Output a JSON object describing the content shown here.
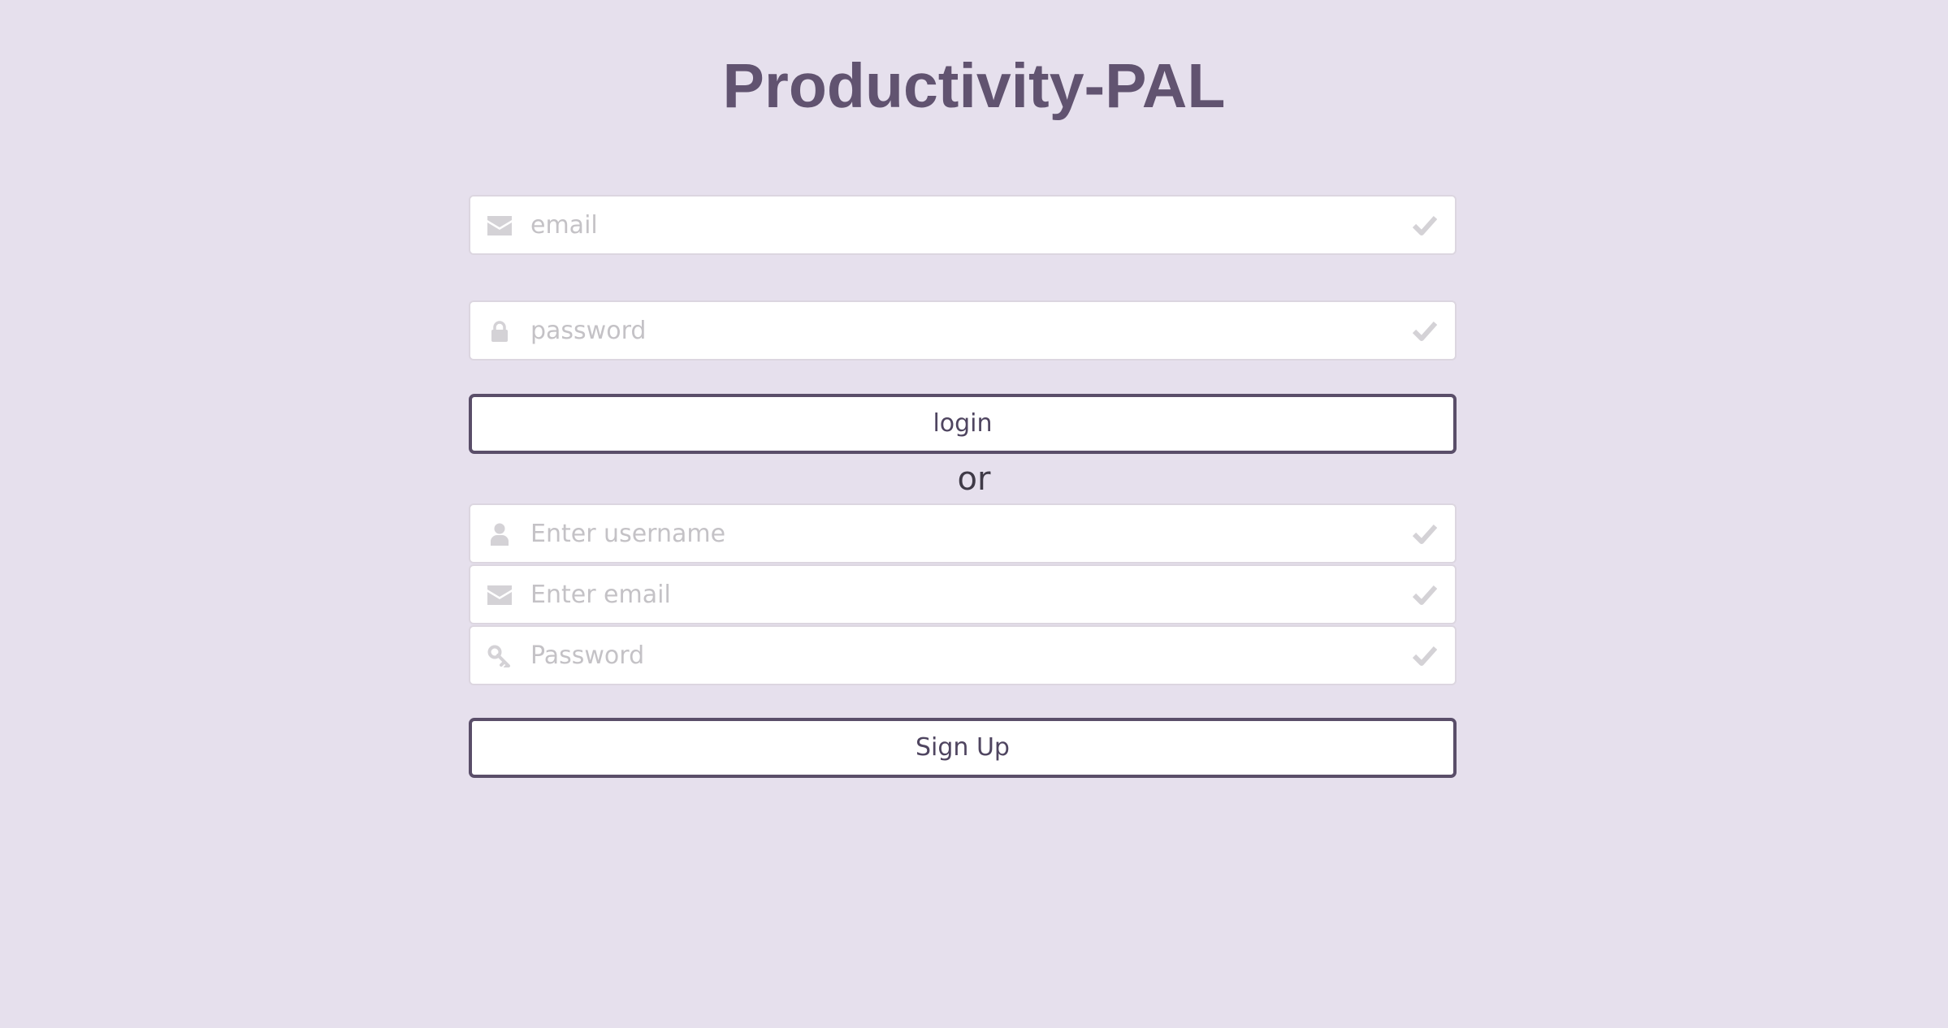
{
  "app": {
    "title": "Productivity-PAL"
  },
  "login": {
    "email_placeholder": "email",
    "password_placeholder": "password",
    "button_label": "login",
    "email_icon": "envelope-icon",
    "password_icon": "lock-icon"
  },
  "separator": {
    "label": "or"
  },
  "signup": {
    "username_placeholder": "Enter username",
    "email_placeholder": "Enter email",
    "password_placeholder": "Password",
    "button_label": "Sign Up",
    "username_icon": "user-icon",
    "email_icon": "envelope-icon",
    "password_icon": "key-icon"
  },
  "colors": {
    "background": "#e6e0ed",
    "title": "#615370",
    "button_border": "#5a4e69",
    "icon_gray": "#d4d2d6"
  }
}
